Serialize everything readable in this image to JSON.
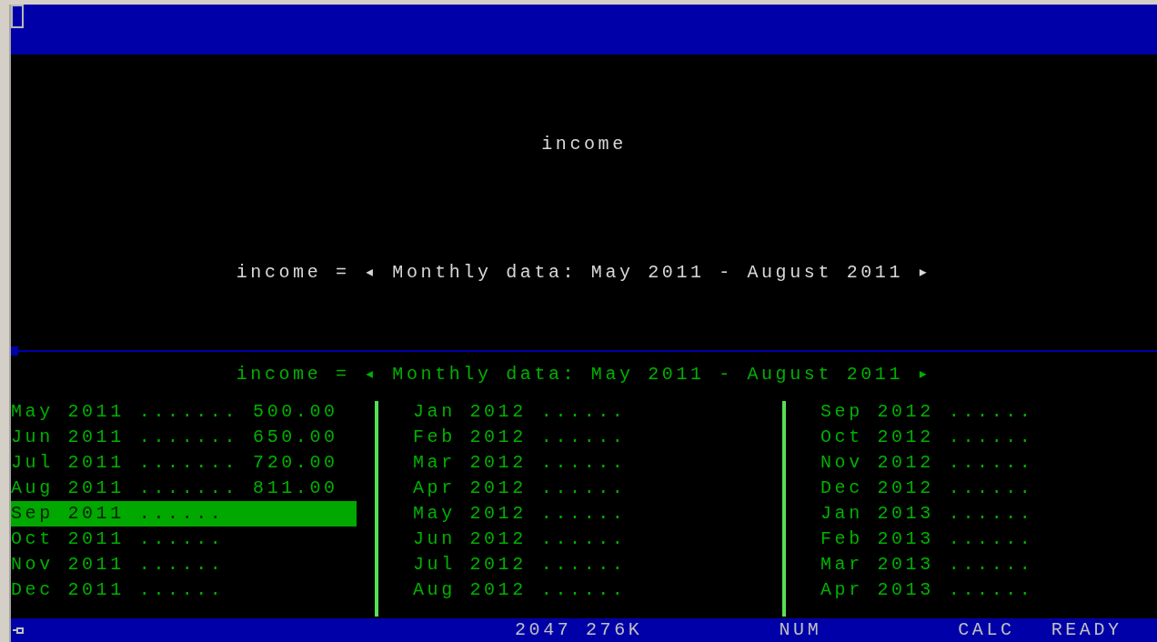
{
  "upper_pane": {
    "title": "income",
    "formula": "income = ◂ Monthly data: May 2011 - August 2011 ▸"
  },
  "lower_pane": {
    "formula": "income = ◂ Monthly data: May 2011 - August 2011 ▸",
    "columns": [
      {
        "rows": [
          {
            "label": "May 2011",
            "leader": ".......",
            "value": "500.00",
            "selected": false
          },
          {
            "label": "Jun 2011",
            "leader": ".......",
            "value": "650.00",
            "selected": false
          },
          {
            "label": "Jul 2011",
            "leader": ".......",
            "value": "720.00",
            "selected": false
          },
          {
            "label": "Aug 2011",
            "leader": ".......",
            "value": "811.00",
            "selected": false
          },
          {
            "label": "Sep 2011",
            "leader": "......",
            "selected": true
          },
          {
            "label": "Oct 2011",
            "leader": "......",
            "selected": false
          },
          {
            "label": "Nov 2011",
            "leader": "......",
            "selected": false
          },
          {
            "label": "Dec 2011",
            "leader": "......",
            "selected": false
          }
        ]
      },
      {
        "rows": [
          {
            "label": "Jan 2012",
            "leader": "......",
            "selected": false
          },
          {
            "label": "Feb 2012",
            "leader": "......",
            "selected": false
          },
          {
            "label": "Mar 2012",
            "leader": "......",
            "selected": false
          },
          {
            "label": "Apr 2012",
            "leader": "......",
            "selected": false
          },
          {
            "label": "May 2012",
            "leader": "......",
            "selected": false
          },
          {
            "label": "Jun 2012",
            "leader": "......",
            "selected": false
          },
          {
            "label": "Jul 2012",
            "leader": "......",
            "selected": false
          },
          {
            "label": "Aug 2012",
            "leader": "......",
            "selected": false
          }
        ]
      },
      {
        "rows": [
          {
            "label": "Sep 2012",
            "leader": "......",
            "selected": false
          },
          {
            "label": "Oct 2012",
            "leader": "......",
            "selected": false
          },
          {
            "label": "Nov 2012",
            "leader": "......",
            "selected": false
          },
          {
            "label": "Dec 2012",
            "leader": "......",
            "selected": false
          },
          {
            "label": "Jan 2013",
            "leader": "......",
            "selected": false
          },
          {
            "label": "Feb 2013",
            "leader": "......",
            "selected": false
          },
          {
            "label": "Mar 2013",
            "leader": "......",
            "selected": false
          },
          {
            "label": "Apr 2013",
            "leader": "......",
            "selected": false
          }
        ]
      }
    ]
  },
  "status_bar": {
    "memory": "2047 276K",
    "num": "NUM",
    "calc": "CALC",
    "mode": "READY"
  }
}
